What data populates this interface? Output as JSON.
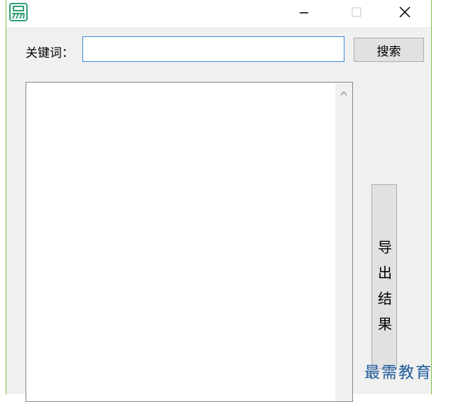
{
  "titlebar": {
    "icon": "app-logo-icon",
    "minimize_icon": "minimize-icon",
    "maximize_icon": "maximize-icon",
    "close_icon": "close-icon"
  },
  "search": {
    "label": "关键词：",
    "value": "",
    "button_label": "搜索"
  },
  "results": {
    "items": [],
    "scroll_icon": "chevron-up-icon"
  },
  "export": {
    "label": "导出结果"
  },
  "watermark": {
    "text": "最需教育"
  },
  "colors": {
    "accent_border": "#3b8ad9",
    "window_edge": "#7cc24a",
    "logo": "#2f9e72",
    "watermark": "#1f5a9a"
  }
}
